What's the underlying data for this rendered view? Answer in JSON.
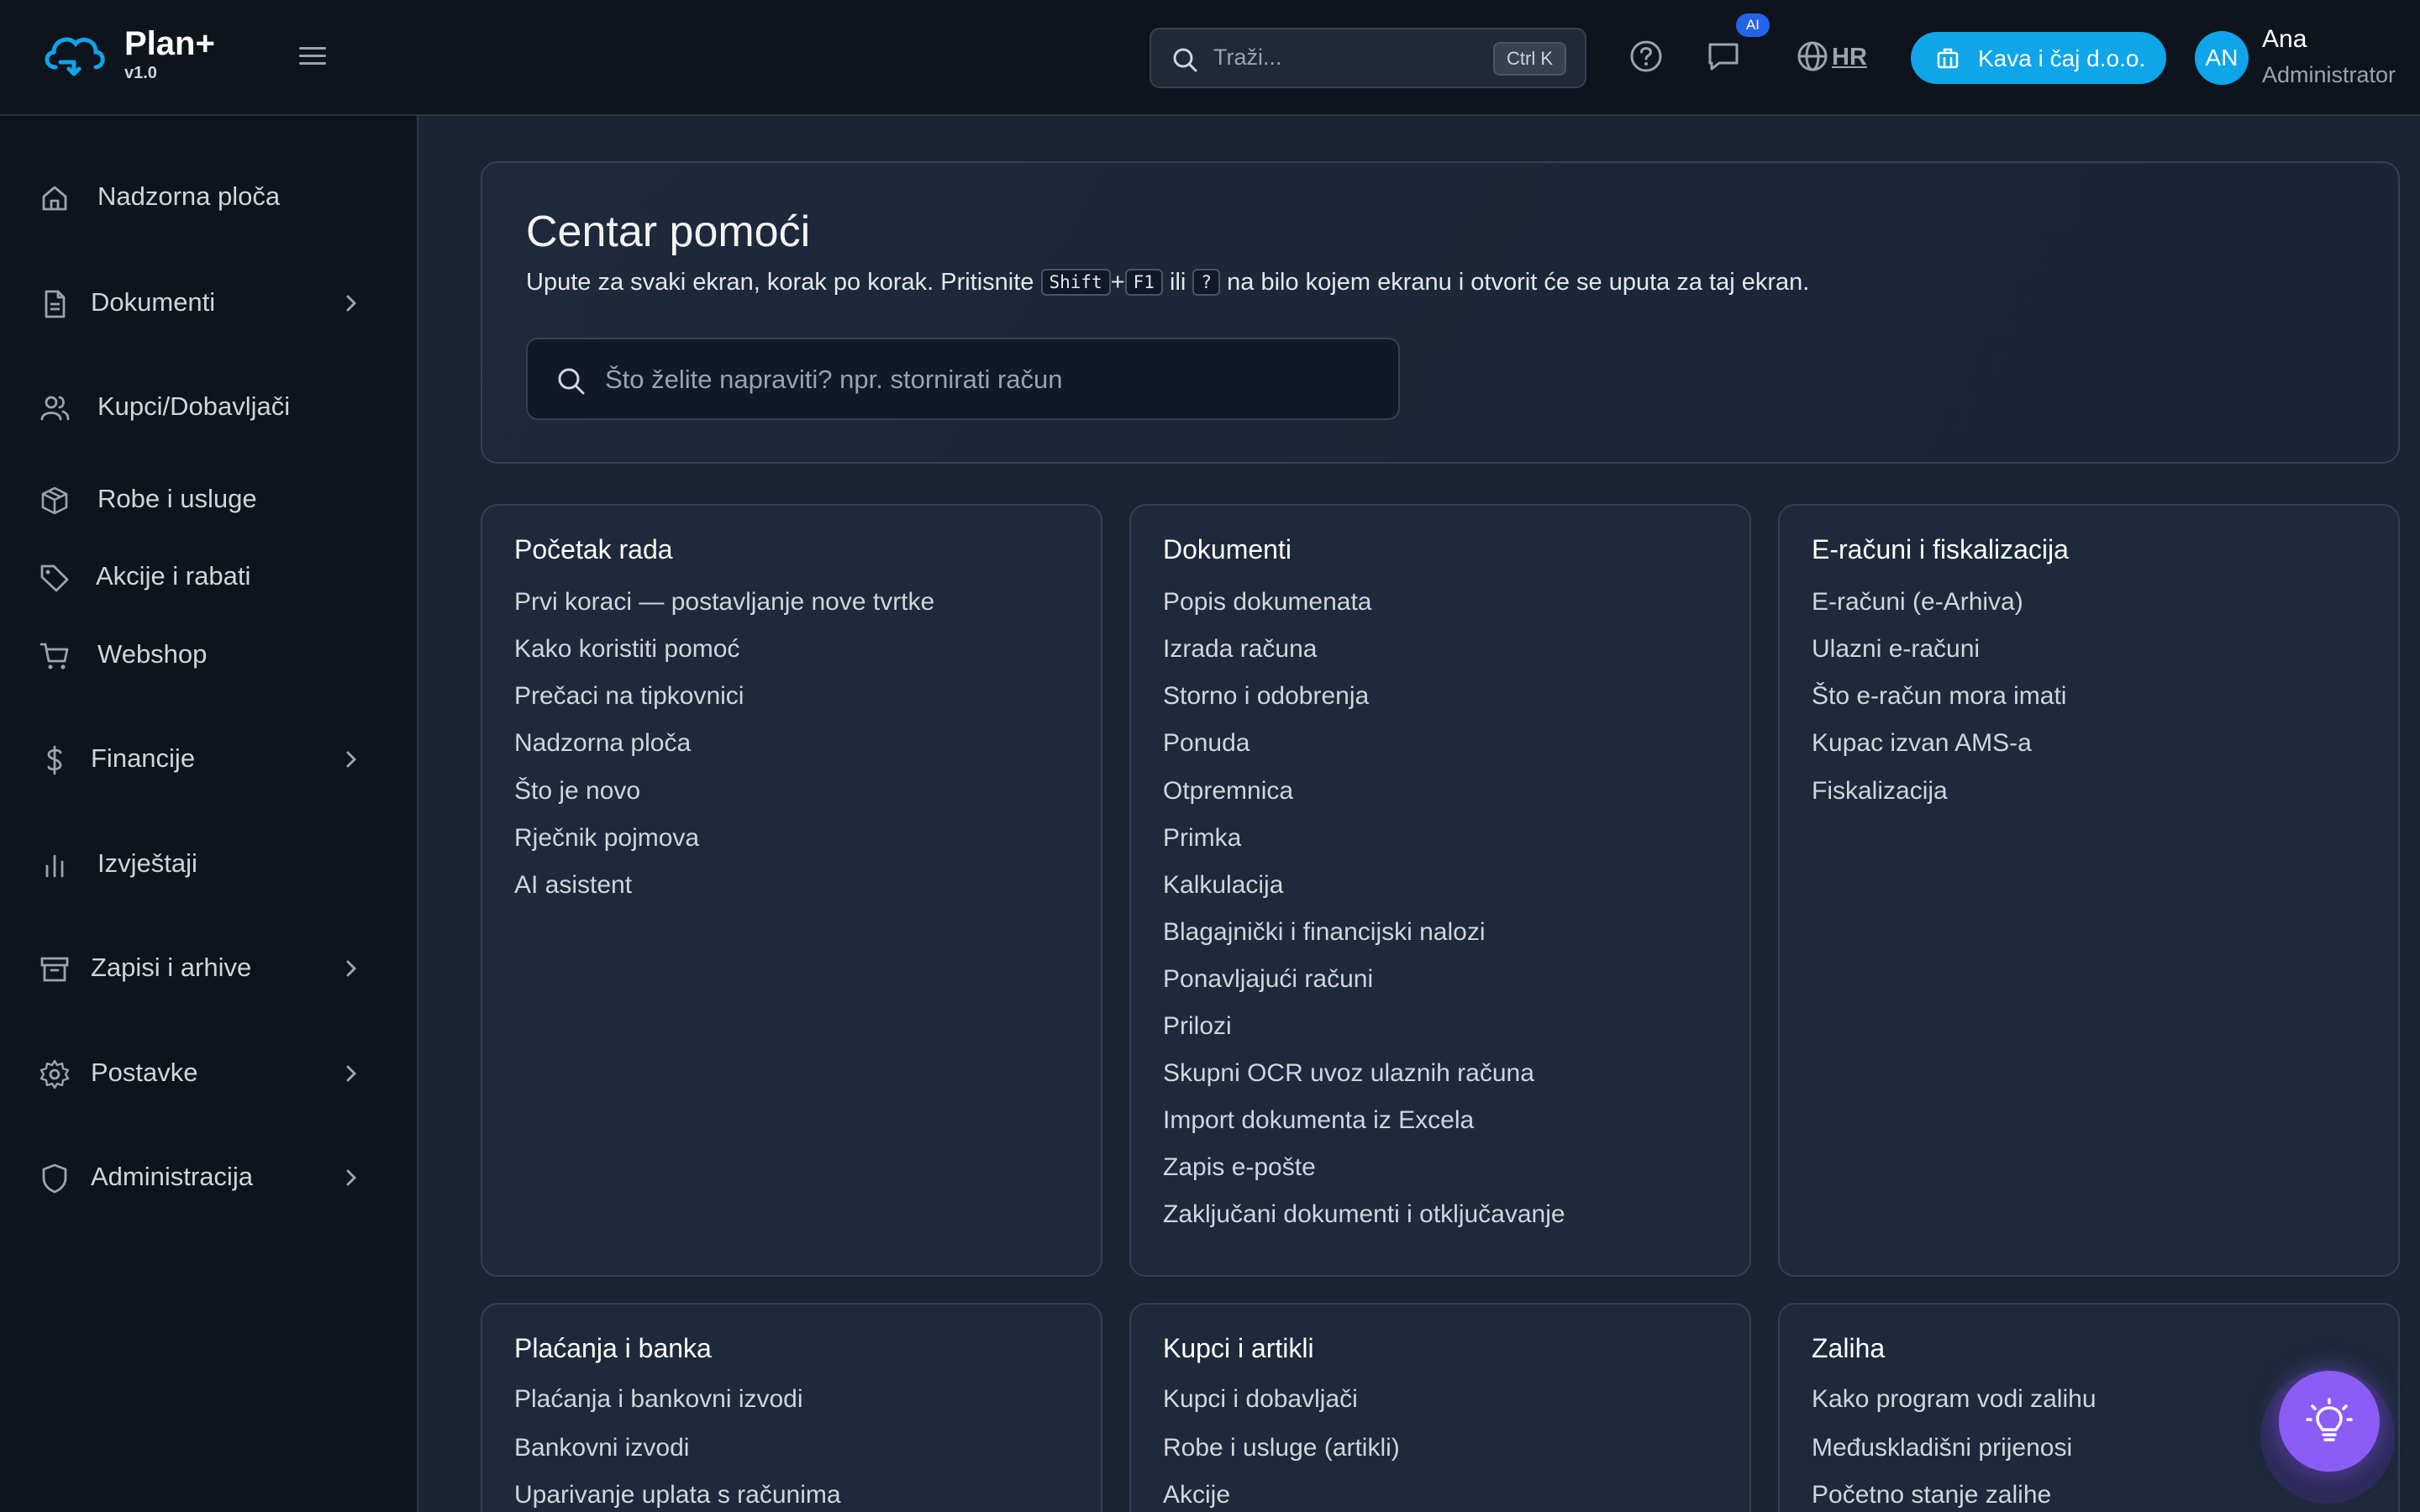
{
  "header": {
    "brand_name": "Plan+",
    "brand_version": "v1.0",
    "search_placeholder": "Traži...",
    "search_shortcut": "Ctrl K",
    "ai_badge": "AI",
    "language": "HR",
    "company_button": "Kava i čaj d.o.o.",
    "avatar_initials": "AN",
    "user_name": "Ana",
    "user_role": "Administrator",
    "icons": [
      "cloud-logo-icon",
      "menu-icon",
      "search-icon",
      "help-icon",
      "chat-icon",
      "globe-icon",
      "building-icon"
    ]
  },
  "sidebar": {
    "items": [
      {
        "label": "Nadzorna ploča",
        "icon": "home-icon",
        "has_submenu": false
      },
      {
        "label": "Dokumenti",
        "icon": "document-icon",
        "has_submenu": true
      },
      {
        "label": "Kupci/Dobavljači",
        "icon": "users-icon",
        "has_submenu": false
      },
      {
        "label": "Robe i usluge",
        "icon": "box-icon",
        "has_submenu": false
      },
      {
        "label": "Akcije i rabati",
        "icon": "tag-icon",
        "has_submenu": false
      },
      {
        "label": "Webshop",
        "icon": "cart-icon",
        "has_submenu": false
      },
      {
        "label": "Financije",
        "icon": "dollar-icon",
        "has_submenu": true
      },
      {
        "label": "Izvještaji",
        "icon": "chart-icon",
        "has_submenu": false
      },
      {
        "label": "Zapisi i arhive",
        "icon": "archive-icon",
        "has_submenu": true
      },
      {
        "label": "Postavke",
        "icon": "gear-icon",
        "has_submenu": true
      },
      {
        "label": "Administracija",
        "icon": "shield-icon",
        "has_submenu": true
      }
    ]
  },
  "hero": {
    "title": "Centar pomoći",
    "subtitle_before": "Upute za svaki ekran, korak po korak. Pritisnite",
    "key_shift": "Shift",
    "plus": "+",
    "key_f1": "F1",
    "or": "ili",
    "key_question": "?",
    "subtitle_after": "na bilo kojem ekranu i otvorit će se uputa za taj ekran.",
    "search_placeholder": "Što želite napraviti? npr. stornirati račun"
  },
  "cards": [
    {
      "title": "Početak rada",
      "links": [
        "Prvi koraci — postavljanje nove tvrtke",
        "Kako koristiti pomoć",
        "Prečaci na tipkovnici",
        "Nadzorna ploča",
        "Što je novo",
        "Rječnik pojmova",
        "AI asistent"
      ]
    },
    {
      "title": "Dokumenti",
      "links": [
        "Popis dokumenata",
        "Izrada računa",
        "Storno i odobrenja",
        "Ponuda",
        "Otpremnica",
        "Primka",
        "Kalkulacija",
        "Blagajnički i financijski nalozi",
        "Ponavljajući računi",
        "Prilozi",
        "Skupni OCR uvoz ulaznih računa",
        "Import dokumenta iz Excela",
        "Zapis e-pošte",
        "Zaključani dokumenti i otključavanje"
      ]
    },
    {
      "title": "E-računi i fiskalizacija",
      "links": [
        "E-računi (e-Arhiva)",
        "Ulazni e-računi",
        "Što e-račun mora imati",
        "Kupac izvan AMS-a",
        "Fiskalizacija"
      ]
    },
    {
      "title": "Plaćanja i banka",
      "links": [
        "Plaćanja i bankovni izvodi",
        "Bankovni izvodi",
        "Uparivanje uplata s računima"
      ]
    },
    {
      "title": "Kupci i artikli",
      "links": [
        "Kupci i dobavljači",
        "Robe i usluge (artikli)",
        "Akcije"
      ]
    },
    {
      "title": "Zaliha",
      "links": [
        "Kako program vodi zalihu",
        "Međuskladišni prijenosi",
        "Početno stanje zalihe"
      ]
    }
  ],
  "fab_icon": "lightbulb-icon"
}
